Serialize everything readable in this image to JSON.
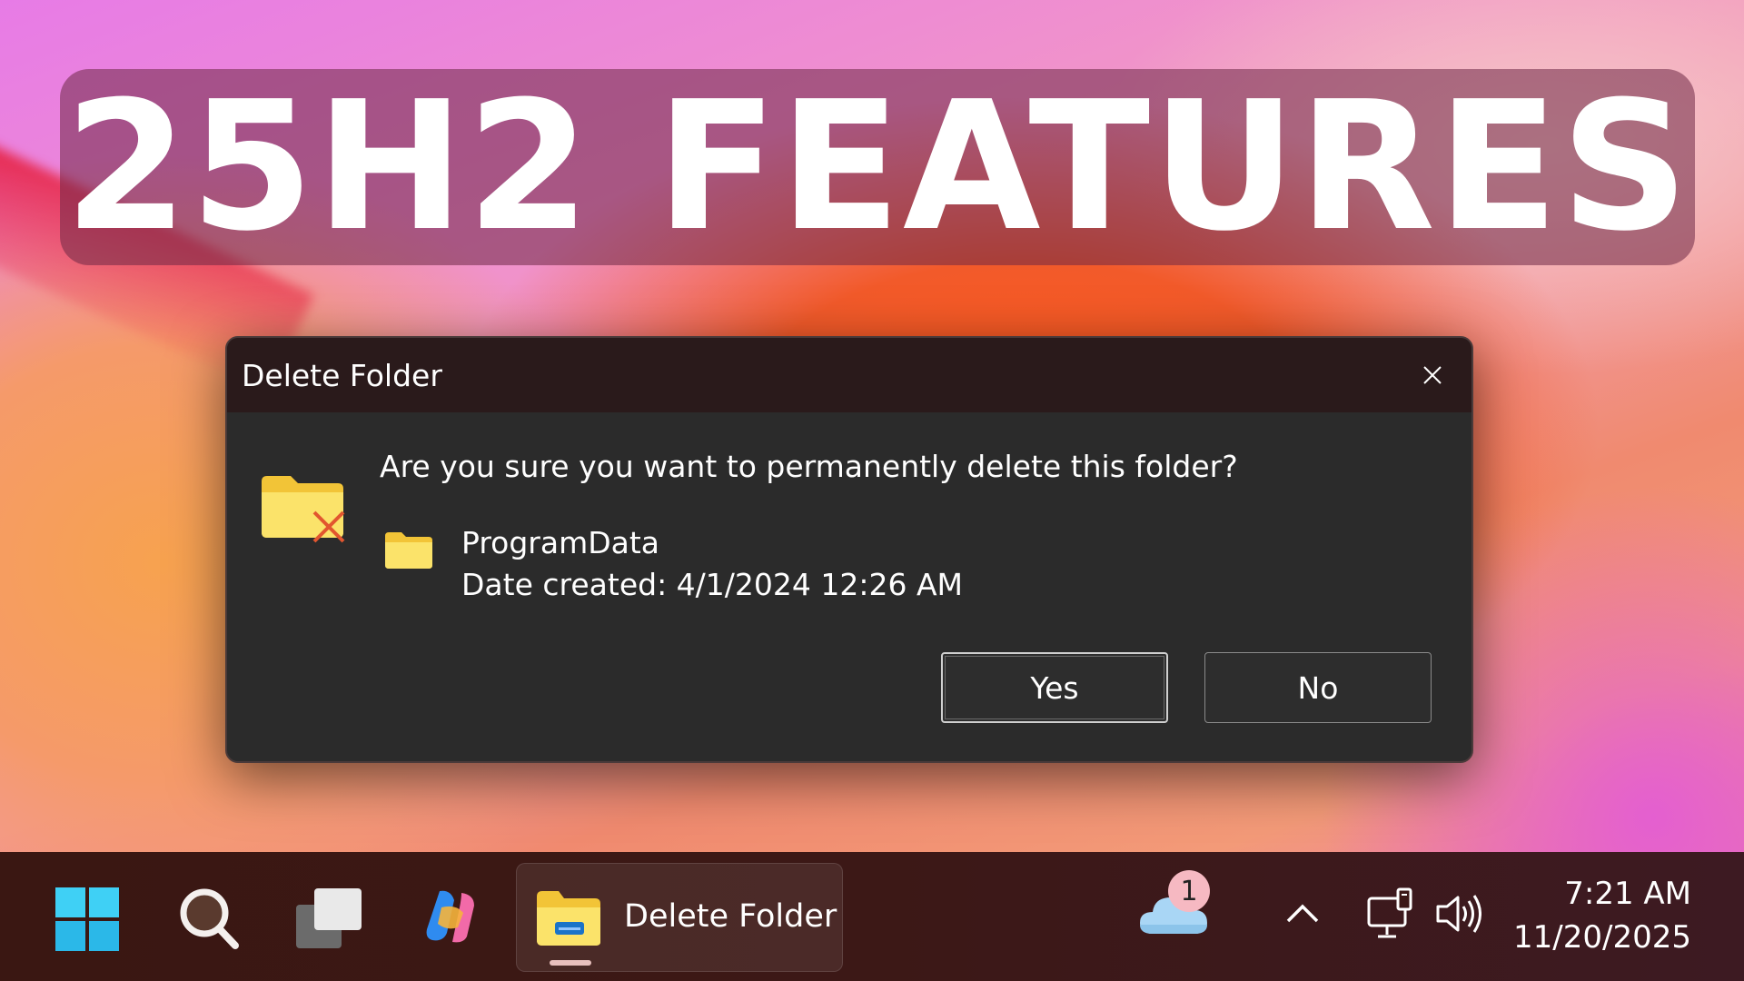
{
  "banner": {
    "text": "25H2 FEATURES"
  },
  "dialog": {
    "title": "Delete Folder",
    "question": "Are you sure you want to permanently delete this folder?",
    "item": {
      "name": "ProgramData",
      "date_created": "Date created: 4/1/2024 12:26 AM"
    },
    "buttons": {
      "yes": "Yes",
      "no": "No"
    },
    "close_icon": "close-icon"
  },
  "taskbar": {
    "start_icon": "windows-start-icon",
    "search_icon": "search-icon",
    "taskview_icon": "task-view-icon",
    "copilot_icon": "copilot-icon",
    "active_app": {
      "label": "Delete Folder",
      "icon": "file-explorer-icon"
    },
    "weather": {
      "icon": "cloud-icon",
      "badge": "1"
    },
    "tray": {
      "chevron_icon": "chevron-up-icon",
      "network_icon": "network-icon",
      "volume_icon": "volume-icon"
    },
    "clock": {
      "time": "7:21 AM",
      "date": "11/20/2025"
    }
  },
  "colors": {
    "dialog_bg": "#2b2b2b",
    "titlebar_bg": "#2a1a1b",
    "taskbar_bg": "#3c1816",
    "folder_yellow": "#f6d84b",
    "delete_x": "#e2562f"
  }
}
